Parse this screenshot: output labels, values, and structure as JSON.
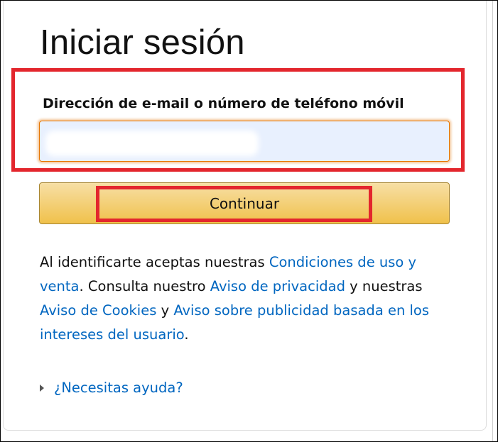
{
  "page": {
    "title": "Iniciar sesión"
  },
  "form": {
    "email_label": "Dirección de e-mail o número de teléfono móvil",
    "email_value": "",
    "continue_label": "Continuar"
  },
  "legal": {
    "part1": "Al identificarte aceptas nuestras ",
    "link_conditions": "Condiciones de uso y venta",
    "part2": ". Consulta nuestro ",
    "link_privacy": "Aviso de privacidad",
    "part3": " y nuestras ",
    "link_cookies": "Aviso de Cookies",
    "part4": " y ",
    "link_ads": "Aviso sobre publicidad basada en los intereses del usuario",
    "part5": "."
  },
  "help": {
    "label": "¿Necesitas ayuda?",
    "icon": "caret-right-icon"
  },
  "colors": {
    "highlight": "#e3262d",
    "link": "#0066c0",
    "button_top": "#f7dfa5",
    "button_bottom": "#f0c14b",
    "input_bg": "#e8f0fe",
    "input_focus": "#e77600"
  }
}
